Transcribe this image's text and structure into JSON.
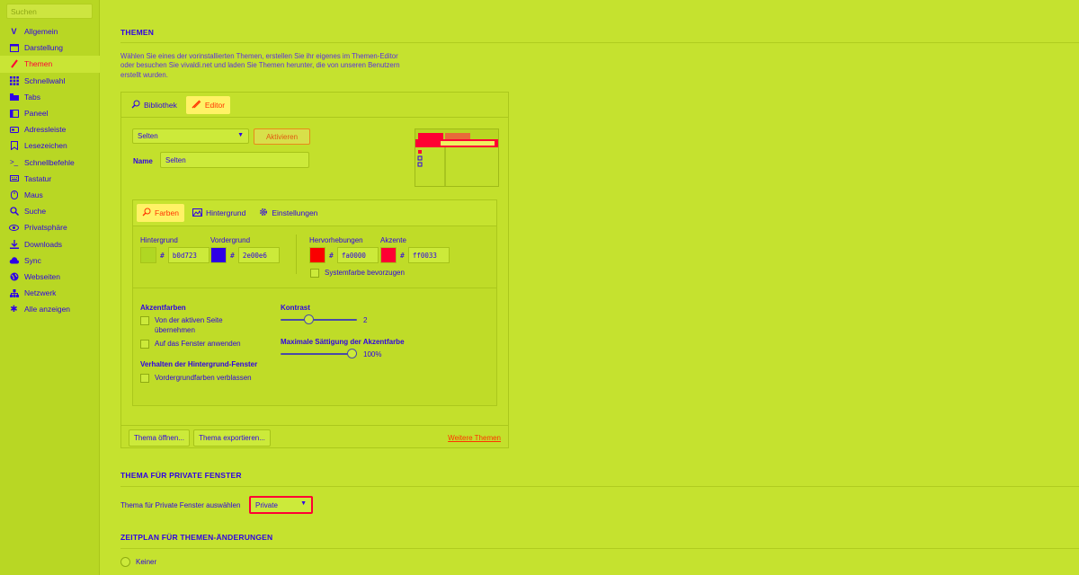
{
  "sidebar": {
    "search_placeholder": "Suchen",
    "items": [
      {
        "label": "Allgemein",
        "icon": "vivaldi-icon"
      },
      {
        "label": "Darstellung",
        "icon": "window-icon"
      },
      {
        "label": "Themen",
        "icon": "brush-icon",
        "active": true
      },
      {
        "label": "Schnellwahl",
        "icon": "grid-icon"
      },
      {
        "label": "Tabs",
        "icon": "tabs-icon"
      },
      {
        "label": "Paneel",
        "icon": "panel-icon"
      },
      {
        "label": "Adressleiste",
        "icon": "address-bar-icon"
      },
      {
        "label": "Lesezeichen",
        "icon": "bookmark-icon"
      },
      {
        "label": "Schnellbefehle",
        "icon": "command-icon"
      },
      {
        "label": "Tastatur",
        "icon": "keyboard-icon"
      },
      {
        "label": "Maus",
        "icon": "mouse-icon"
      },
      {
        "label": "Suche",
        "icon": "search-icon"
      },
      {
        "label": "Privatsphäre",
        "icon": "eye-icon"
      },
      {
        "label": "Downloads",
        "icon": "download-icon"
      },
      {
        "label": "Sync",
        "icon": "cloud-icon"
      },
      {
        "label": "Webseiten",
        "icon": "globe-icon"
      },
      {
        "label": "Netzwerk",
        "icon": "network-icon"
      },
      {
        "label": "Alle anzeigen",
        "icon": "gear-icon"
      }
    ]
  },
  "themes": {
    "title": "THEMEN",
    "description": "Wählen Sie eines der vorinstallierten Themen, erstellen Sie ihr eigenes im Themen-Editor oder besuchen Sie vivaldi.net und laden Sie Themen herunter, die von unseren Benutzern erstellt wurden.",
    "tabs": {
      "library": "Bibliothek",
      "editor": "Editor"
    },
    "selected_theme": "Selten",
    "activate_button": "Aktivieren",
    "name_label": "Name",
    "name_value": "Selten",
    "editor_tabs": {
      "colors": "Farben",
      "background": "Hintergrund",
      "settings": "Einstellungen"
    },
    "colors": {
      "background": {
        "label": "Hintergrund",
        "hex": "b0d723",
        "color": "#b0d723"
      },
      "foreground": {
        "label": "Vordergrund",
        "hex": "2e00e6",
        "color": "#2e00e6"
      },
      "highlight": {
        "label": "Hervorhebungen",
        "hex": "fa0000",
        "color": "#fa0000"
      },
      "accent": {
        "label": "Akzente",
        "hex": "ff0033",
        "color": "#ff0033"
      }
    },
    "hash": "#",
    "system_color_label": "Systemfarbe bevorzugen",
    "accent_colors": {
      "heading": "Akzentfarben",
      "from_page": "Von der aktiven Seite übernehmen",
      "apply_window": "Auf das Fenster anwenden"
    },
    "background_behavior": {
      "heading": "Verhalten der Hintergrund-Fenster",
      "fade": "Vordergrundfarben verblassen"
    },
    "contrast": {
      "label": "Kontrast",
      "value": "2",
      "fraction": 0.35
    },
    "saturation": {
      "label": "Maximale Sättigung der Akzentfarbe",
      "value": "100%",
      "fraction": 1.0
    },
    "footer": {
      "open_button": "Thema öffnen...",
      "export_button": "Thema exportieren...",
      "more_link": "Weitere Themen"
    }
  },
  "private": {
    "title": "THEMA FÜR PRIVATE FENSTER",
    "select_label": "Thema für Private Fenster auswählen",
    "selected": "Private"
  },
  "schedule": {
    "title": "ZEITPLAN FÜR THEMEN-ÄNDERUNGEN",
    "option_none": "Keiner"
  },
  "accent_colors_ui": {
    "link": "#ff3300",
    "accent": "#ff0033",
    "text": "#2e00e6",
    "bg": "#c5e22f"
  }
}
